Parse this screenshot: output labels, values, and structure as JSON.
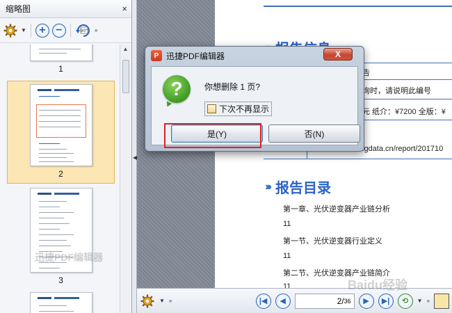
{
  "panel": {
    "title": "缩略图",
    "close_label": "×",
    "thumbnails": [
      {
        "page": "1"
      },
      {
        "page": "2"
      },
      {
        "page": "3"
      }
    ]
  },
  "document": {
    "section_top_title": "报告信息",
    "partial_lines": [
      "告",
      "询时，请说明此编号",
      "元   纸介：¥7200   全版：¥",
      "igdata.cn/report/201710"
    ],
    "toc_title": "报告目录",
    "toc_items": [
      "第一章、光伏逆变器产业链分析",
      "11",
      "第一节、光伏逆变器行业定义",
      "11",
      "第二节、光伏逆变器产业链简介",
      "11"
    ]
  },
  "bottom_bar": {
    "current_page": "2",
    "total_pages": "36"
  },
  "dialog": {
    "title": "迅捷PDF编辑器",
    "app_icon_glyph": "P",
    "close_label": "X",
    "question": "你想删除 1 页?",
    "checkbox_label": "下次不再显示",
    "yes_label": "是(Y)",
    "no_label": "否(N)"
  },
  "watermark": {
    "left_text": "迅捷PDF编辑器",
    "right_text": "Baidu经验"
  },
  "colors": {
    "accent_blue": "#2a64c8",
    "selection": "#fbe6b4",
    "highlight_red": "#e02020"
  }
}
